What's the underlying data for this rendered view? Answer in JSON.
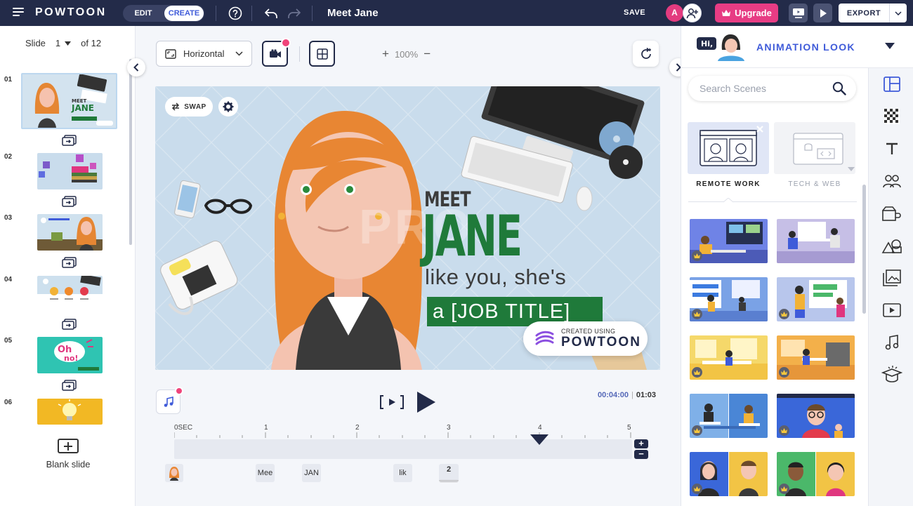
{
  "topbar": {
    "brand": "POWTOON",
    "mode_edit": "EDIT",
    "mode_create": "CREATE",
    "project_title": "Meet Jane",
    "save_label": "SAVE",
    "avatar_initial": "A",
    "upgrade_label": "Upgrade",
    "export_label": "EXPORT",
    "colors": {
      "bar": "#232b49",
      "upgrade": "#e73c84",
      "avatar": "#e33b7f"
    }
  },
  "slides_panel": {
    "slide_word": "Slide",
    "current": "1",
    "total": "of 12",
    "slides": [
      {
        "number": "01",
        "selected": true
      },
      {
        "number": "02"
      },
      {
        "number": "03"
      },
      {
        "number": "04"
      },
      {
        "number": "05"
      },
      {
        "number": "06"
      }
    ],
    "blank_slide_label": "Blank slide"
  },
  "canvas": {
    "orientation_label": "Horizontal",
    "zoom_level": "100%",
    "swap_label": "SWAP",
    "slide_text": {
      "meet": "MEET",
      "name": "JANE",
      "tagline": "like you, she's",
      "job": "a [JOB TITLE]",
      "created_small": "CREATED USING",
      "created_brand": "POWTOON"
    }
  },
  "timeline": {
    "current_time": "00:04:00",
    "total_time": "01:03",
    "ruler_labels": [
      "0SEC",
      "1",
      "2",
      "3",
      "4",
      "5"
    ],
    "layers": [
      "Mee",
      "JAN",
      "lik",
      "2"
    ]
  },
  "library": {
    "header_title": "ANIMATION LOOK",
    "search_placeholder": "Search Scenes",
    "categories": [
      {
        "label": "REMOTE WORK",
        "active": true
      },
      {
        "label": "TECH & WEB",
        "active": false
      }
    ],
    "rail_icons": [
      "layout-icon",
      "pattern-icon",
      "text-icon",
      "characters-icon",
      "props-icon",
      "shapes-icon",
      "media-icon",
      "video-icon",
      "music-icon",
      "learning-icon"
    ]
  }
}
